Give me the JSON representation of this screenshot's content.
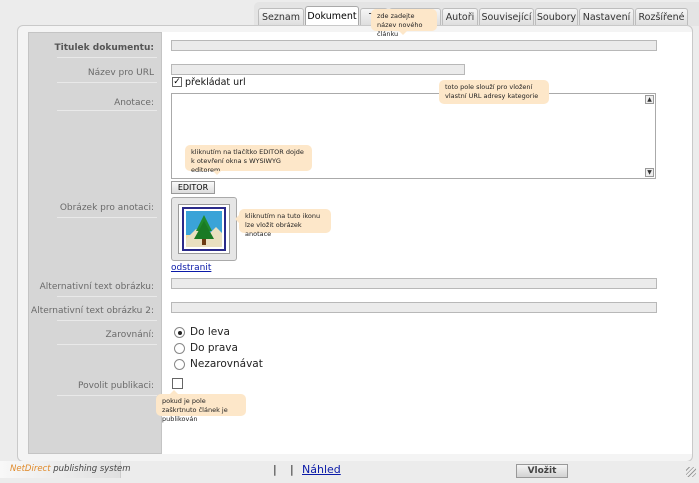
{
  "tabs": [
    {
      "label": "Seznam",
      "active": false
    },
    {
      "label": "Dokument",
      "active": true
    },
    {
      "label": "Tě",
      "active": false
    },
    {
      "label": "",
      "active": false
    },
    {
      "label": "Autoři",
      "active": false
    },
    {
      "label": "Související",
      "active": false
    },
    {
      "label": "Soubory",
      "active": false
    },
    {
      "label": "Nastavení",
      "active": false
    },
    {
      "label": "Rozšířené",
      "active": false
    }
  ],
  "form": {
    "title_label": "Titulek dokumentu:",
    "url_label": "Název pro URL",
    "translate_url_label": "překládat url",
    "annotation_label": "Anotace:",
    "editor_button": "EDITOR",
    "image_label": "Obrázek pro anotaci:",
    "remove_link": "odstranit",
    "alt_label": "Alternativní text obrázku:",
    "alt2_label": "Alternativní text obrázku 2:",
    "align_label": "Zarovnání:",
    "align_options": [
      "Do leva",
      "Do prava",
      "Nezarovnávat"
    ],
    "publish_label": "Povolit publikaci:"
  },
  "tips": {
    "title": "zde zadejte název nového článku",
    "url": "toto pole slouží pro vložení vlastní URL adresy kategorie",
    "editor": "kliknutím na tlačítko EDITOR dojde k otevření okna s WYSIWYG editorem",
    "image": "kliknutím na tuto ikonu lze vložit obrázek anotace",
    "publish": "pokud je pole zaškrtnuto článek je publikován"
  },
  "footer": {
    "brand_name": "NetDirect",
    "brand_rest": " publishing system",
    "sep1": "|",
    "sep2": "|",
    "preview": "Náhled",
    "submit": "Vložit"
  }
}
